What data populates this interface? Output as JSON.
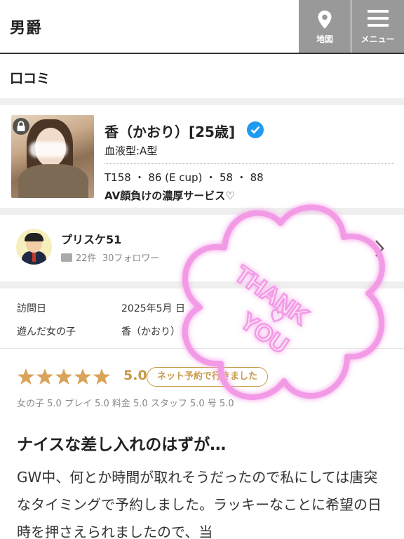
{
  "header": {
    "logo": "男爵",
    "map_label": "地図",
    "menu_label": "メニュー"
  },
  "section": {
    "title": "口コミ"
  },
  "girl": {
    "name": "香（かおり）[25歳]",
    "blood_type": "血液型:A型",
    "stats": "T158 ・ 86 (E cup) ・ 58 ・ 88",
    "catchphrase": "AV顔負けの濃厚サービス♡"
  },
  "reviewer": {
    "name": "プリスケ51",
    "reviews": "22件",
    "followers": "30フォロワー"
  },
  "visit": {
    "date_label": "訪問日",
    "date_value": "2025年5月 日",
    "girl_label": "遊んだ女の子",
    "girl_value": "香（かおり）"
  },
  "rating": {
    "stars": 5,
    "score": "5.0",
    "badge": "ネット予約で行きました",
    "subscores": "女の子 5.0 プレイ 5.0 料金 5.0 スタッフ 5.0 号 5.0"
  },
  "review": {
    "title": "ナイスな差し入れのはずが…",
    "body": "GW中、何とか時間が取れそうだったので私にしては唐突なタイミングで予約しました。ラッキーなことに希望の日時を押さえられましたので、当"
  },
  "sticker": {
    "text_1": "THANK",
    "text_2": "YOU"
  },
  "colors": {
    "accent_gold": "#c79a4a",
    "verified_blue": "#1d9bf0",
    "header_button": "#999999",
    "sticker_pink": "#f39ae6"
  }
}
